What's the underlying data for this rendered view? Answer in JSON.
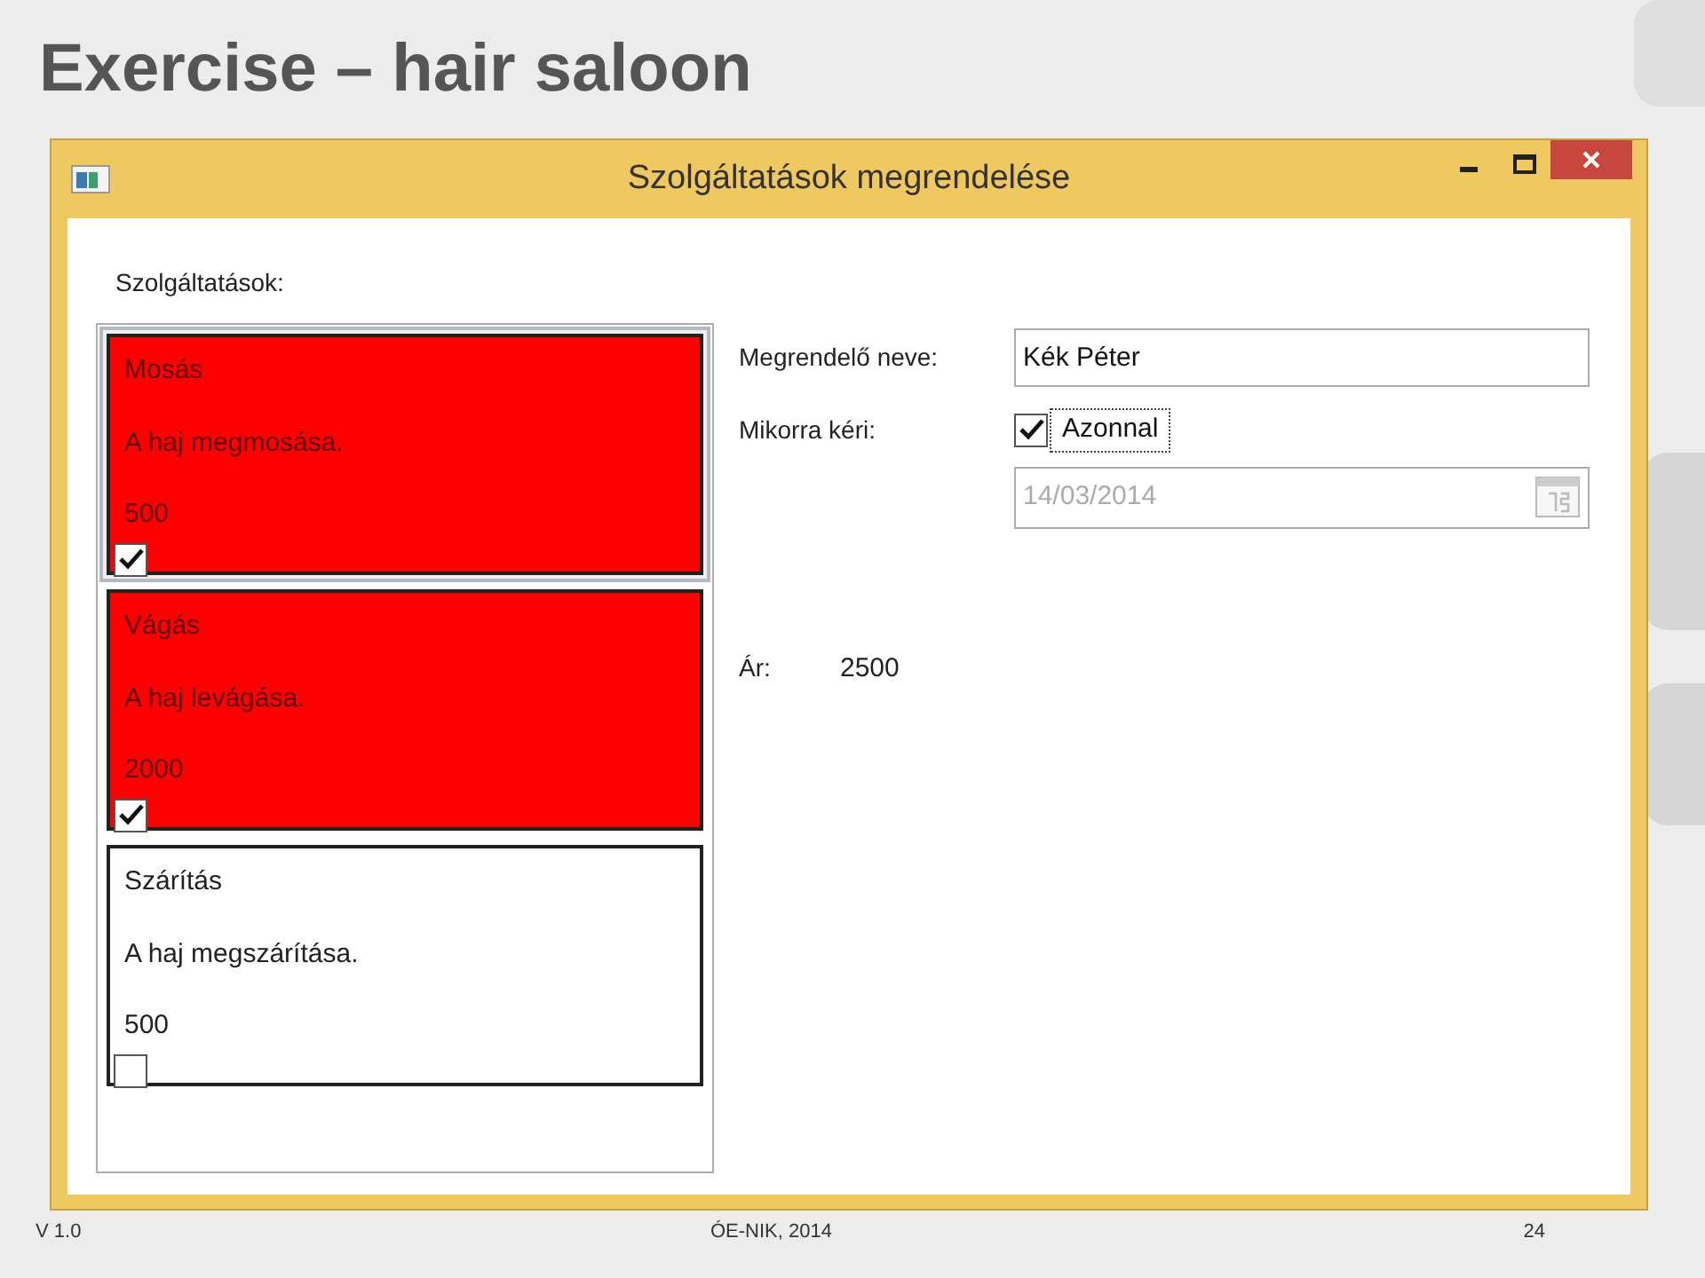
{
  "slide": {
    "title": "Exercise – hair saloon",
    "footer_left": "V 1.0",
    "footer_center": "ÓE-NIK, 2014",
    "page_number": "24"
  },
  "window": {
    "title": "Szolgáltatások megrendelése"
  },
  "services_label": "Szolgáltatások:",
  "services": [
    {
      "name": "Mosás",
      "description": "A haj megmosása.",
      "price": "500",
      "checked": true,
      "selected": true
    },
    {
      "name": "Vágás",
      "description": "A haj levágása.",
      "price": "2000",
      "checked": true,
      "selected": false
    },
    {
      "name": "Szárítás",
      "description": "A haj megszárítása.",
      "price": "500",
      "checked": false,
      "selected": false
    }
  ],
  "customer": {
    "label": "Megrendelő neve:",
    "value": "Kék Péter"
  },
  "when": {
    "label": "Mikorra kéri:",
    "checkbox_label": "Azonnal",
    "checked": true,
    "date": "14/03/2014",
    "disabled": true
  },
  "price": {
    "label": "Ár:",
    "value": "2500"
  }
}
